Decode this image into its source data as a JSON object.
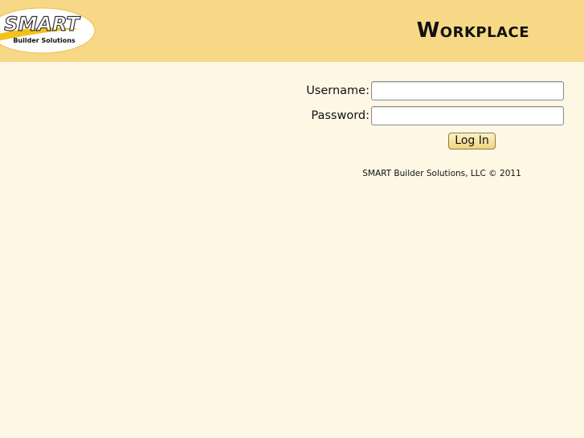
{
  "header": {
    "logo_text": "SMART",
    "logo_subtext": "Builder Solutions",
    "title": "Workplace"
  },
  "login_form": {
    "username_label": "Username:",
    "username_value": "",
    "password_label": "Password:",
    "password_value": "",
    "login_button_label": "Log In"
  },
  "footer": {
    "copyright": "SMART Builder Solutions, LLC © 2011"
  },
  "colors": {
    "header_bg": "#f7d886",
    "page_bg": "#fef7e4",
    "logo_accent": "#f2c21a"
  }
}
